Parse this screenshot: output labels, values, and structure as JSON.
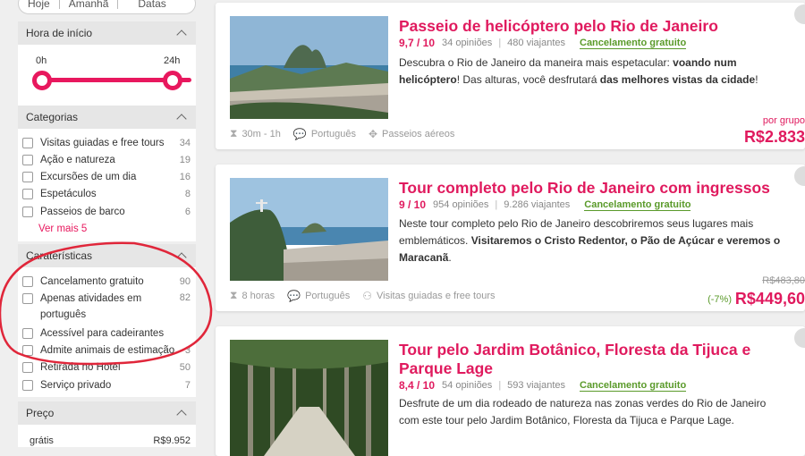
{
  "filters": {
    "date_tabs": [
      "Hoje",
      "Amanhã",
      "Datas"
    ],
    "start_time": {
      "title": "Hora de início",
      "min_label": "0h",
      "max_label": "24h",
      "range": [
        0,
        24
      ]
    },
    "categories": {
      "title": "Categorias",
      "items": [
        {
          "label": "Visitas guiadas e free tours",
          "count": "34"
        },
        {
          "label": "Ação e natureza",
          "count": "19"
        },
        {
          "label": "Excursões de um dia",
          "count": "16"
        },
        {
          "label": "Espetáculos",
          "count": "8"
        },
        {
          "label": "Passeios de barco",
          "count": "6"
        }
      ],
      "see_more": "Ver mais 5"
    },
    "features": {
      "title": "Caraterísticas",
      "items": [
        {
          "label": "Cancelamento gratuito",
          "count": "90"
        },
        {
          "label": "Apenas atividades em português",
          "count": "82"
        },
        {
          "label": "Acessível para cadeirantes",
          "count": ""
        },
        {
          "label": "Admite animais de estimação",
          "count": "3"
        },
        {
          "label": "Retirada no Hotel",
          "count": "50"
        },
        {
          "label": "Serviço privado",
          "count": "7"
        }
      ]
    },
    "price": {
      "title": "Preço",
      "min_label": "grátis",
      "max_label": "R$9.952"
    }
  },
  "tours": [
    {
      "title": "Passeio de helicóptero pelo Rio de Janeiro",
      "score": "9,7 / 10",
      "reviews": "34 opiniões",
      "travelers": "480 viajantes",
      "cancel": "Cancelamento gratuito",
      "desc": [
        "Descubra o Rio de Janeiro da maneira mais espetacular: ",
        "voando num helicóptero",
        "! Das alturas, você desfrutará ",
        "das melhores vistas da cidade",
        "!"
      ],
      "duration": "30m - 1h",
      "language": "Português",
      "category": "Passeios aéreos",
      "price_note": "por grupo",
      "price": "R$2.833",
      "old_price": "",
      "discount": ""
    },
    {
      "title": "Tour completo pelo Rio de Janeiro com ingressos",
      "score": "9 / 10",
      "reviews": "954 opiniões",
      "travelers": "9.286 viajantes",
      "cancel": "Cancelamento gratuito",
      "desc": [
        "Neste tour completo pelo Rio de Janeiro descobriremos seus lugares mais emblemáticos. ",
        "Visitaremos o Cristo Redentor, o Pão de Açúcar e veremos o Maracanã",
        "."
      ],
      "duration": "8 horas",
      "language": "Português",
      "category": "Visitas guiadas e free tours",
      "price_note": "",
      "price": "R$449,60",
      "old_price": "R$483,80",
      "discount": "(-7%)"
    },
    {
      "title": "Tour pelo Jardim Botânico, Floresta da Tijuca e Parque Lage",
      "score": "8,4 / 10",
      "reviews": "54 opiniões",
      "travelers": "593 viajantes",
      "cancel": "Cancelamento gratuito",
      "desc": [
        "Desfrute de um dia rodeado de natureza nas zonas verdes do Rio de Janeiro com este tour pelo Jardim Botânico, Floresta da Tijuca e Parque Lage.",
        "",
        ""
      ],
      "duration": "",
      "language": "",
      "category": "",
      "price_note": "",
      "price": "",
      "old_price": "",
      "discount": ""
    }
  ],
  "colors": {
    "accent": "#e01a5e",
    "success": "#5a9a2a",
    "annotation": "#e0263a"
  }
}
